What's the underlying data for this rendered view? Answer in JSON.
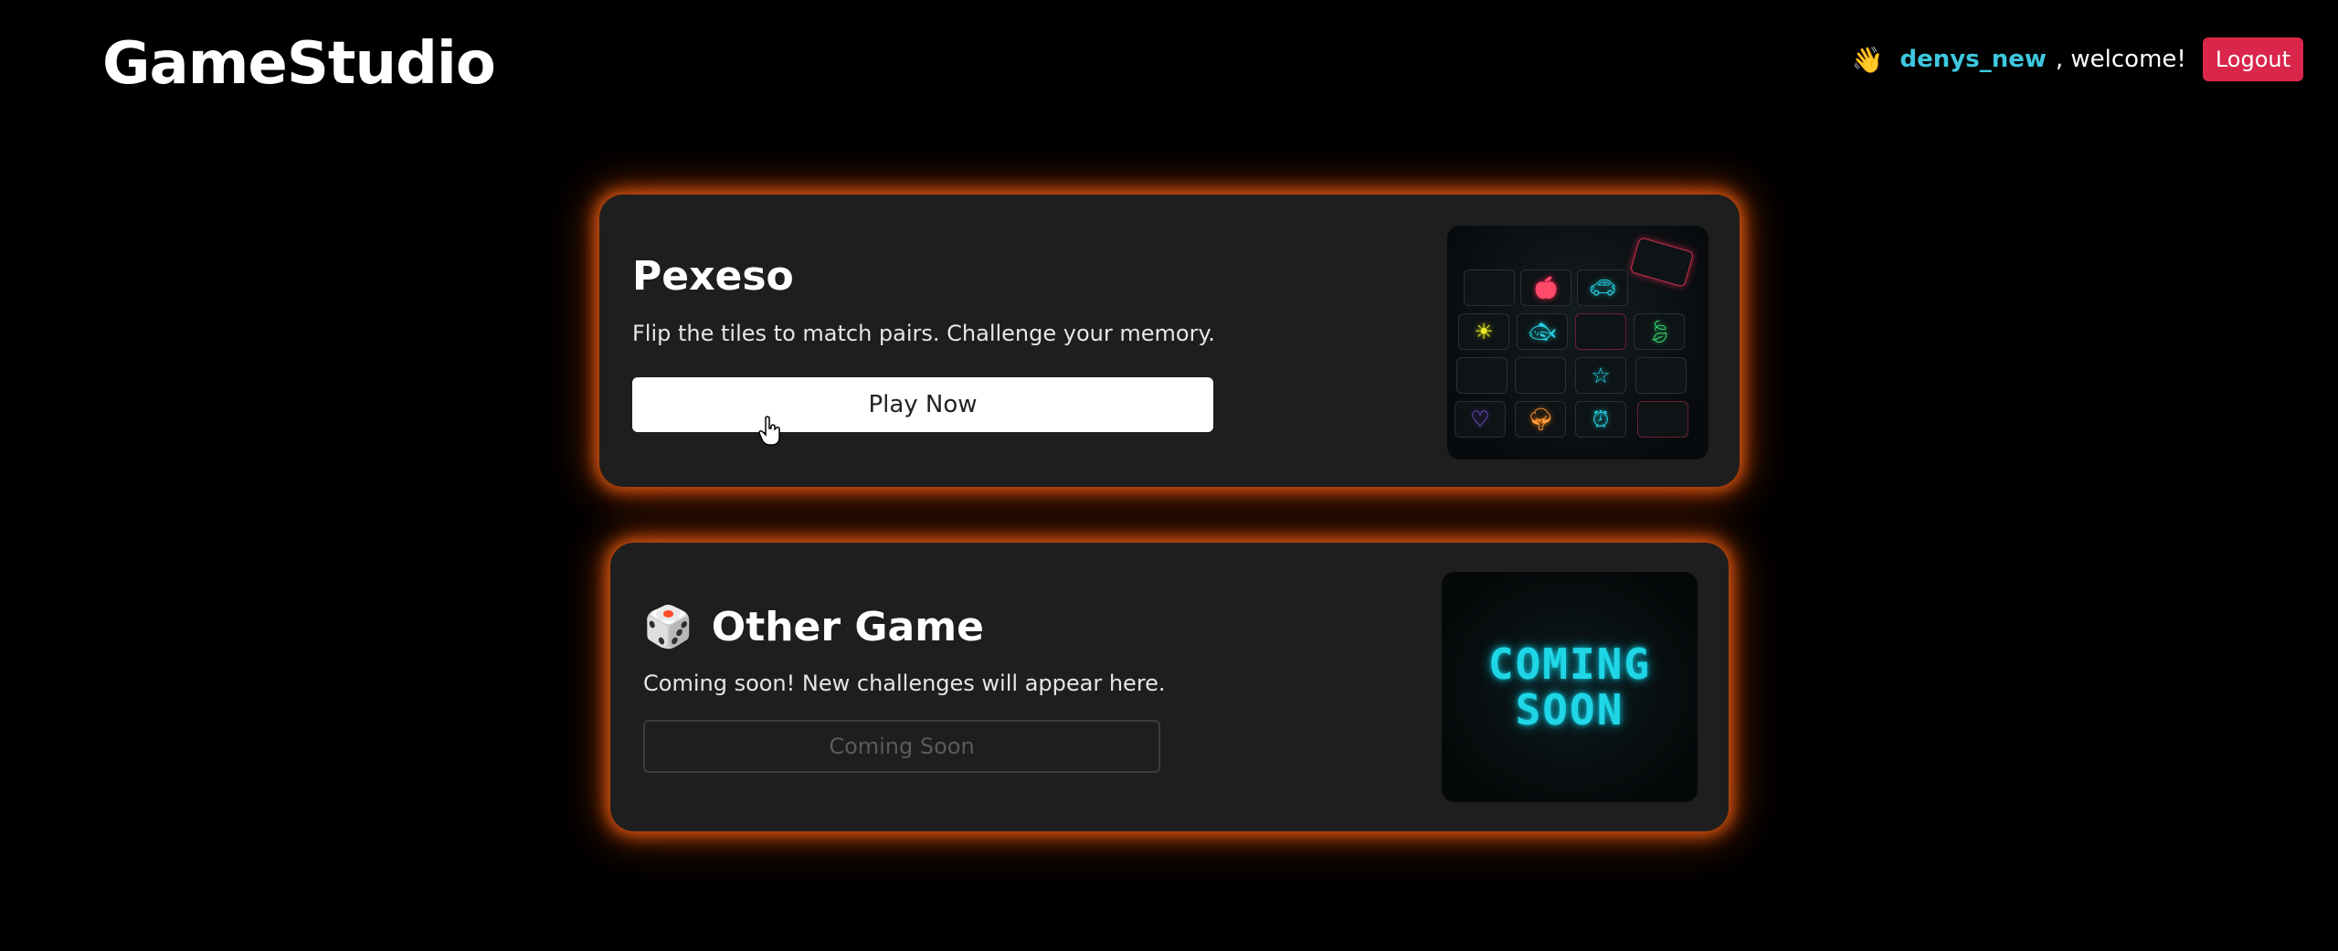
{
  "header": {
    "logo": "GameStudio",
    "wave_emoji": "👋",
    "username": "denys_new",
    "welcome_text": ", welcome!",
    "logout_label": "Logout"
  },
  "games": [
    {
      "title": "Pexeso",
      "description": "Flip the tiles to match pairs. Challenge your memory.",
      "button_label": "Play Now",
      "thumbnail": "pexeso-tiles-neon"
    },
    {
      "icon": "🎲",
      "title": "Other Game",
      "description": "Coming soon! New challenges will appear here.",
      "button_label": "Coming Soon",
      "thumbnail_text_line1": "COMING",
      "thumbnail_text_line2": "SOON"
    }
  ],
  "colors": {
    "accent_glow": "#e85a10",
    "username": "#3ec8df",
    "logout": "#d9264a",
    "card_bg": "#1e1e1e"
  }
}
